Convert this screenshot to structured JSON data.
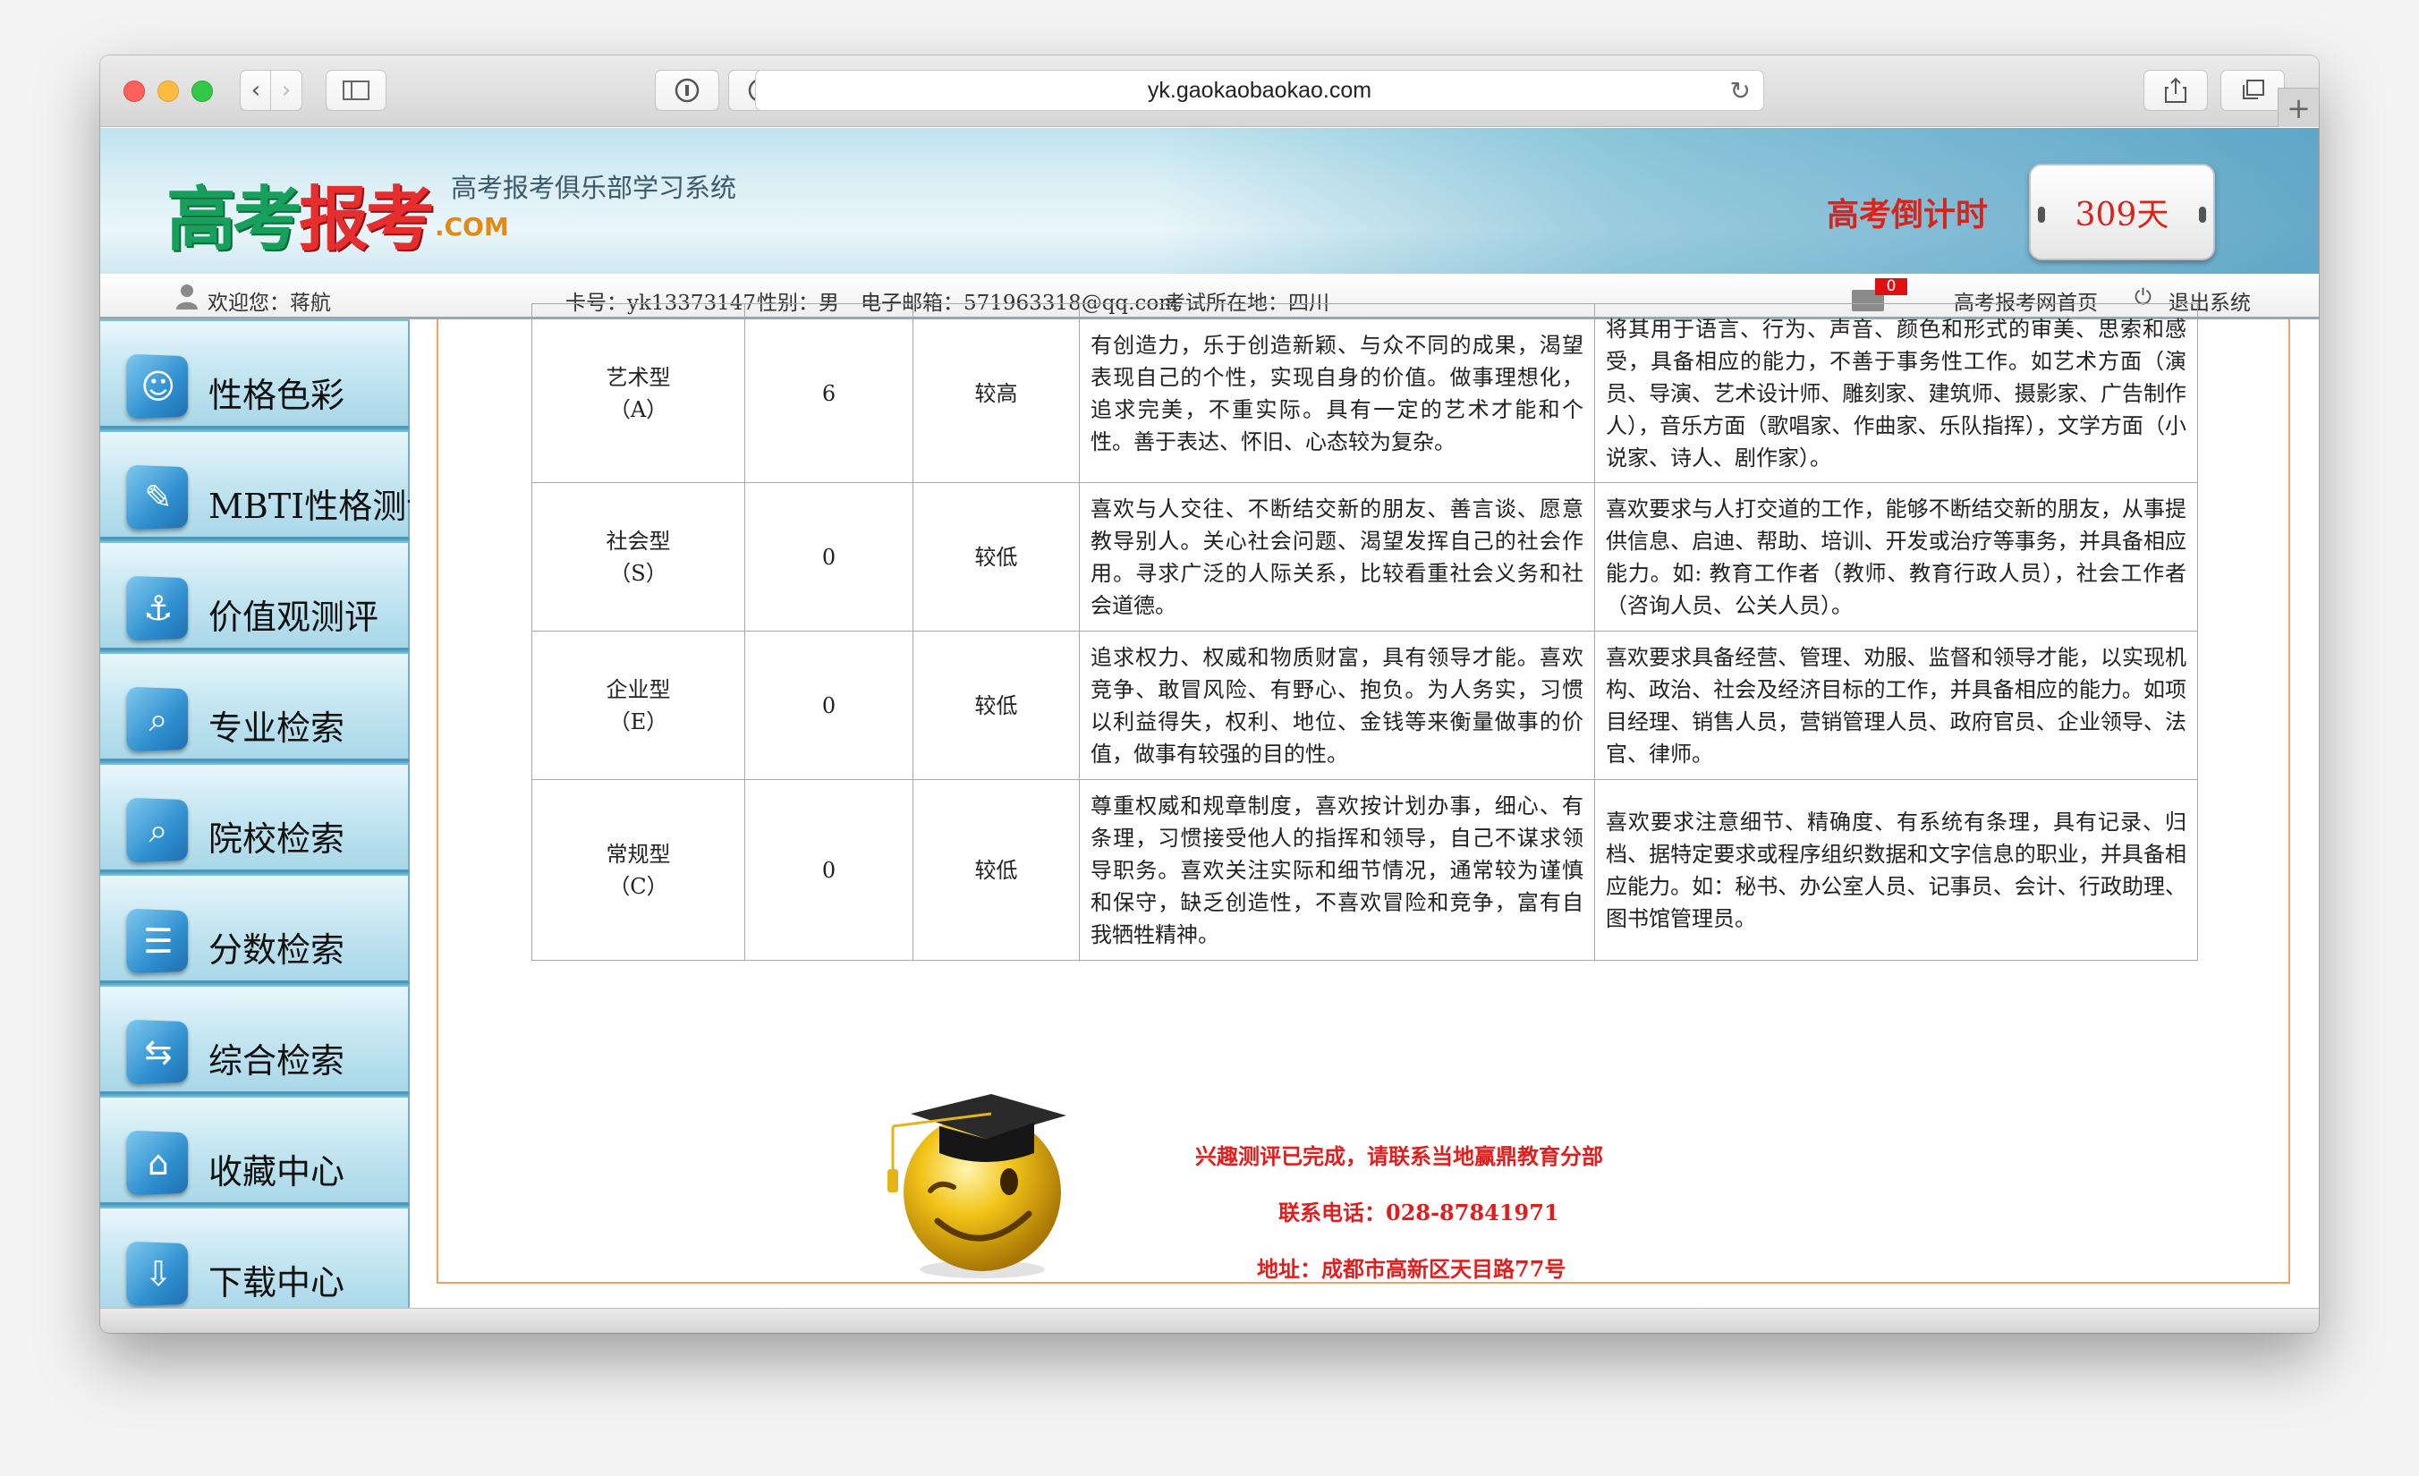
{
  "browser": {
    "url": "yk.gaokaobaokao.com"
  },
  "header": {
    "logo_text_1": "高考",
    "logo_text_2": "报考",
    "logo_com": ".COM",
    "subtitle": "高考报考俱乐部学习系统",
    "countdown_label": "高考倒计时",
    "countdown_value": "309天"
  },
  "infobar": {
    "welcome": "欢迎您：蒋航",
    "card": "卡号：yk13373147",
    "gender": "性别：男",
    "email": "电子邮箱：571963318@qq.com",
    "exam_location": "考试所在地：四川",
    "mail_count": "0",
    "home_link": "高考报考网首页",
    "logout": "退出系统"
  },
  "sidebar": {
    "items": [
      {
        "label": "性格色彩",
        "icon": "mask-icon"
      },
      {
        "label": "MBTI性格测评",
        "icon": "feather-icon"
      },
      {
        "label": "价值观测评",
        "icon": "anchor-icon"
      },
      {
        "label": "专业检索",
        "icon": "search-doc-icon"
      },
      {
        "label": "院校检索",
        "icon": "school-search-icon"
      },
      {
        "label": "分数检索",
        "icon": "list-icon"
      },
      {
        "label": "综合检索",
        "icon": "signpost-icon"
      },
      {
        "label": "收藏中心",
        "icon": "collection-icon"
      },
      {
        "label": "下载中心",
        "icon": "download-icon"
      }
    ]
  },
  "table": {
    "rows": [
      {
        "type": "艺术型",
        "code": "（A）",
        "score": "6",
        "level": "较高",
        "trait": "有创造力，乐于创造新颖、与众不同的成果，渴望表现自己的个性，实现自身的价值。做事理想化，追求完美，不重实际。具有一定的艺术才能和个性。善于表达、怀旧、心态较为复杂。",
        "career": "将其用于语言、行为、声音、颜色和形式的审美、思索和感受，具备相应的能力，不善于事务性工作。如艺术方面（演员、导演、艺术设计师、雕刻家、建筑师、摄影家、广告制作人），音乐方面（歌唱家、作曲家、乐队指挥），文学方面（小说家、诗人、剧作家）。"
      },
      {
        "type": "社会型",
        "code": "（S）",
        "score": "0",
        "level": "较低",
        "trait": "喜欢与人交往、不断结交新的朋友、善言谈、愿意教导别人。关心社会问题、渴望发挥自己的社会作用。寻求广泛的人际关系，比较看重社会义务和社会道德。",
        "career": "喜欢要求与人打交道的工作，能够不断结交新的朋友，从事提供信息、启迪、帮助、培训、开发或治疗等事务，并具备相应能力。如: 教育工作者（教师、教育行政人员），社会工作者（咨询人员、公关人员）。"
      },
      {
        "type": "企业型",
        "code": "（E）",
        "score": "0",
        "level": "较低",
        "trait": "追求权力、权威和物质财富，具有领导才能。喜欢竞争、敢冒风险、有野心、抱负。为人务实，习惯以利益得失，权利、地位、金钱等来衡量做事的价值，做事有较强的目的性。",
        "career": "喜欢要求具备经营、管理、劝服、监督和领导才能，以实现机构、政治、社会及经济目标的工作，并具备相应的能力。如项目经理、销售人员，营销管理人员、政府官员、企业领导、法官、律师。"
      },
      {
        "type": "常规型",
        "code": "（C）",
        "score": "0",
        "level": "较低",
        "trait": "尊重权威和规章制度，喜欢按计划办事，细心、有条理，习惯接受他人的指挥和领导，自己不谋求领导职务。喜欢关注实际和细节情况，通常较为谨慎和保守，缺乏创造性，不喜欢冒险和竞争，富有自我牺牲精神。",
        "career": "喜欢要求注意细节、精确度、有系统有条理，具有记录、归档、据特定要求或程序组织数据和文字信息的职业，并具备相应能力。如：秘书、办公室人员、记事员、会计、行政助理、图书馆管理员。"
      }
    ]
  },
  "notice": {
    "complete": "兴趣测评已完成，请联系当地赢鼎教育分部",
    "phone": "联系电话：028-87841971",
    "address": "地址：成都市高新区天目路77号"
  }
}
